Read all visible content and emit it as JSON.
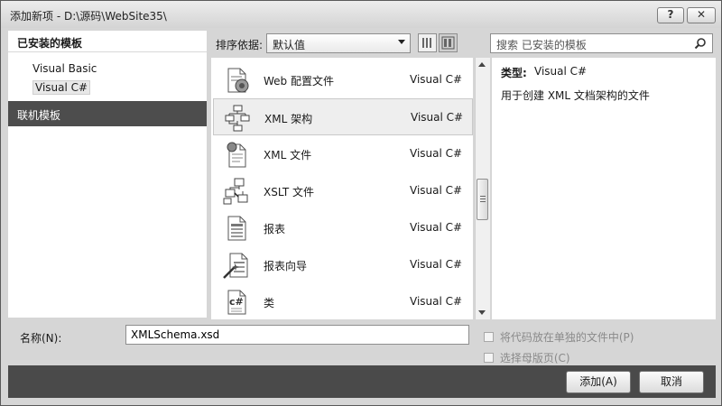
{
  "window": {
    "title": "添加新项 - D:\\源码\\WebSite35\\",
    "help_label": "?",
    "close_label": "✕"
  },
  "left": {
    "header": "已安装的模板",
    "tree": [
      "Visual Basic",
      "Visual C#"
    ],
    "online": "联机模板"
  },
  "toolbar": {
    "sort_label": "排序依据:",
    "sort_value": "默认值",
    "search_placeholder": "搜索 已安装的模板"
  },
  "templates": [
    {
      "name": "Web 配置文件",
      "lang": "Visual C#",
      "icon": "web-config-icon"
    },
    {
      "name": "XML 架构",
      "lang": "Visual C#",
      "icon": "xml-schema-icon",
      "selected": true
    },
    {
      "name": "XML 文件",
      "lang": "Visual C#",
      "icon": "xml-file-icon"
    },
    {
      "name": "XSLT 文件",
      "lang": "Visual C#",
      "icon": "xslt-file-icon"
    },
    {
      "name": "报表",
      "lang": "Visual C#",
      "icon": "report-icon"
    },
    {
      "name": "报表向导",
      "lang": "Visual C#",
      "icon": "report-wizard-icon"
    },
    {
      "name": "类",
      "lang": "Visual C#",
      "icon": "class-icon"
    }
  ],
  "details": {
    "type_label": "类型:",
    "type_value": "Visual C#",
    "description": "用于创建 XML 文档架构的文件"
  },
  "form": {
    "name_label": "名称(N):",
    "name_value": "XMLSchema.xsd",
    "option_separate": "将代码放在单独的文件中(P)",
    "option_master": "选择母版页(C)"
  },
  "buttons": {
    "add": "添加(A)",
    "cancel": "取消"
  }
}
